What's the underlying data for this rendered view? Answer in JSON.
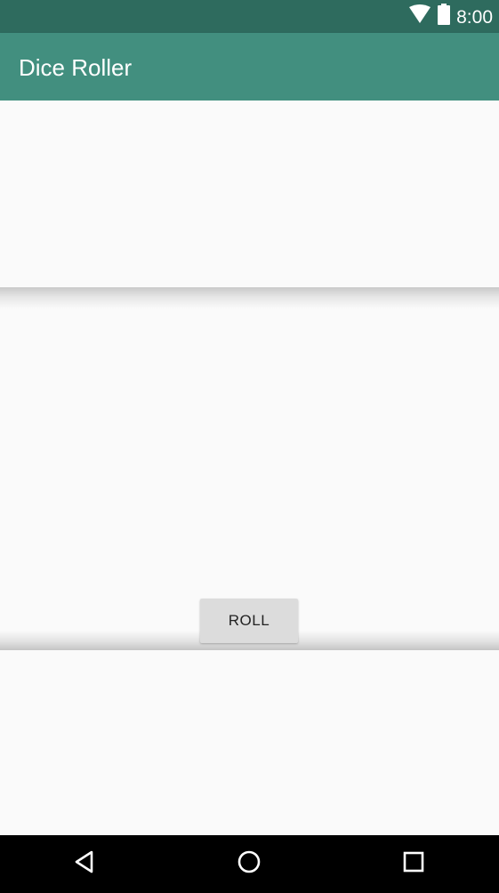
{
  "status_bar": {
    "time": "8:00",
    "icons": [
      "wifi-icon",
      "battery-icon"
    ]
  },
  "app_bar": {
    "title": "Dice Roller"
  },
  "main": {
    "roll_button_label": "ROLL"
  },
  "nav_bar": {
    "buttons": [
      "back-icon",
      "home-icon",
      "recents-icon"
    ]
  },
  "colors": {
    "status_bar": "#2e6b5e",
    "app_bar": "#428f7f",
    "background": "#fafafa",
    "button": "#dcdcdc",
    "nav_bar": "#000000"
  }
}
